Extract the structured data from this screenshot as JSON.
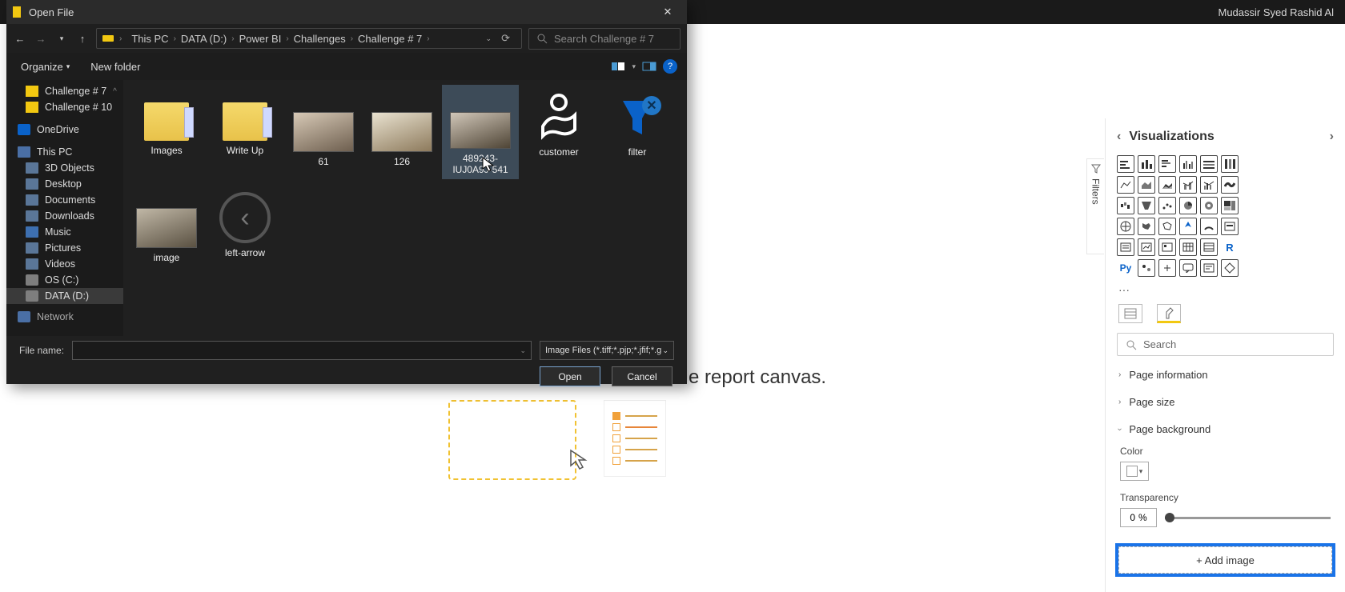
{
  "topbar": {
    "user": "Mudassir Syed Rashid Al"
  },
  "canvas": {
    "partial_text": "e report canvas."
  },
  "dialog": {
    "title": "Open File",
    "search_placeholder": "Search Challenge # 7",
    "breadcrumbs": [
      "This PC",
      "DATA (D:)",
      "Power BI",
      "Challenges",
      "Challenge # 7"
    ],
    "toolbar": {
      "organize": "Organize",
      "new_folder": "New folder"
    },
    "nav_tree": {
      "challenge7": "Challenge # 7",
      "challenge10": "Challenge # 10",
      "onedrive": "OneDrive",
      "this_pc": "This PC",
      "objects3d": "3D Objects",
      "desktop": "Desktop",
      "documents": "Documents",
      "downloads": "Downloads",
      "music": "Music",
      "pictures": "Pictures",
      "videos": "Videos",
      "os_c": "OS (C:)",
      "data_d": "DATA (D:)",
      "network": "Network"
    },
    "files": {
      "images": "Images",
      "writeup": "Write Up",
      "f61": "61",
      "f126": "126",
      "f489": "489243-IUJ0A9J-541",
      "customer": "customer",
      "filter": "filter",
      "image": "image",
      "leftarrow": "left-arrow"
    },
    "footer": {
      "filename_label": "File name:",
      "filetype": "Image Files (*.tiff;*.pjp;*.jfif;*.gi",
      "open": "Open",
      "cancel": "Cancel"
    }
  },
  "viz": {
    "title": "Visualizations",
    "filters_tab": "Filters",
    "search_placeholder": "Search",
    "sections": {
      "page_info": "Page information",
      "page_size": "Page size",
      "page_bg": "Page background"
    },
    "color_label": "Color",
    "transparency_label": "Transparency",
    "transparency_value": "0",
    "transparency_unit": "%",
    "add_image": "+ Add image",
    "r_label": "R",
    "py_label": "Py"
  }
}
